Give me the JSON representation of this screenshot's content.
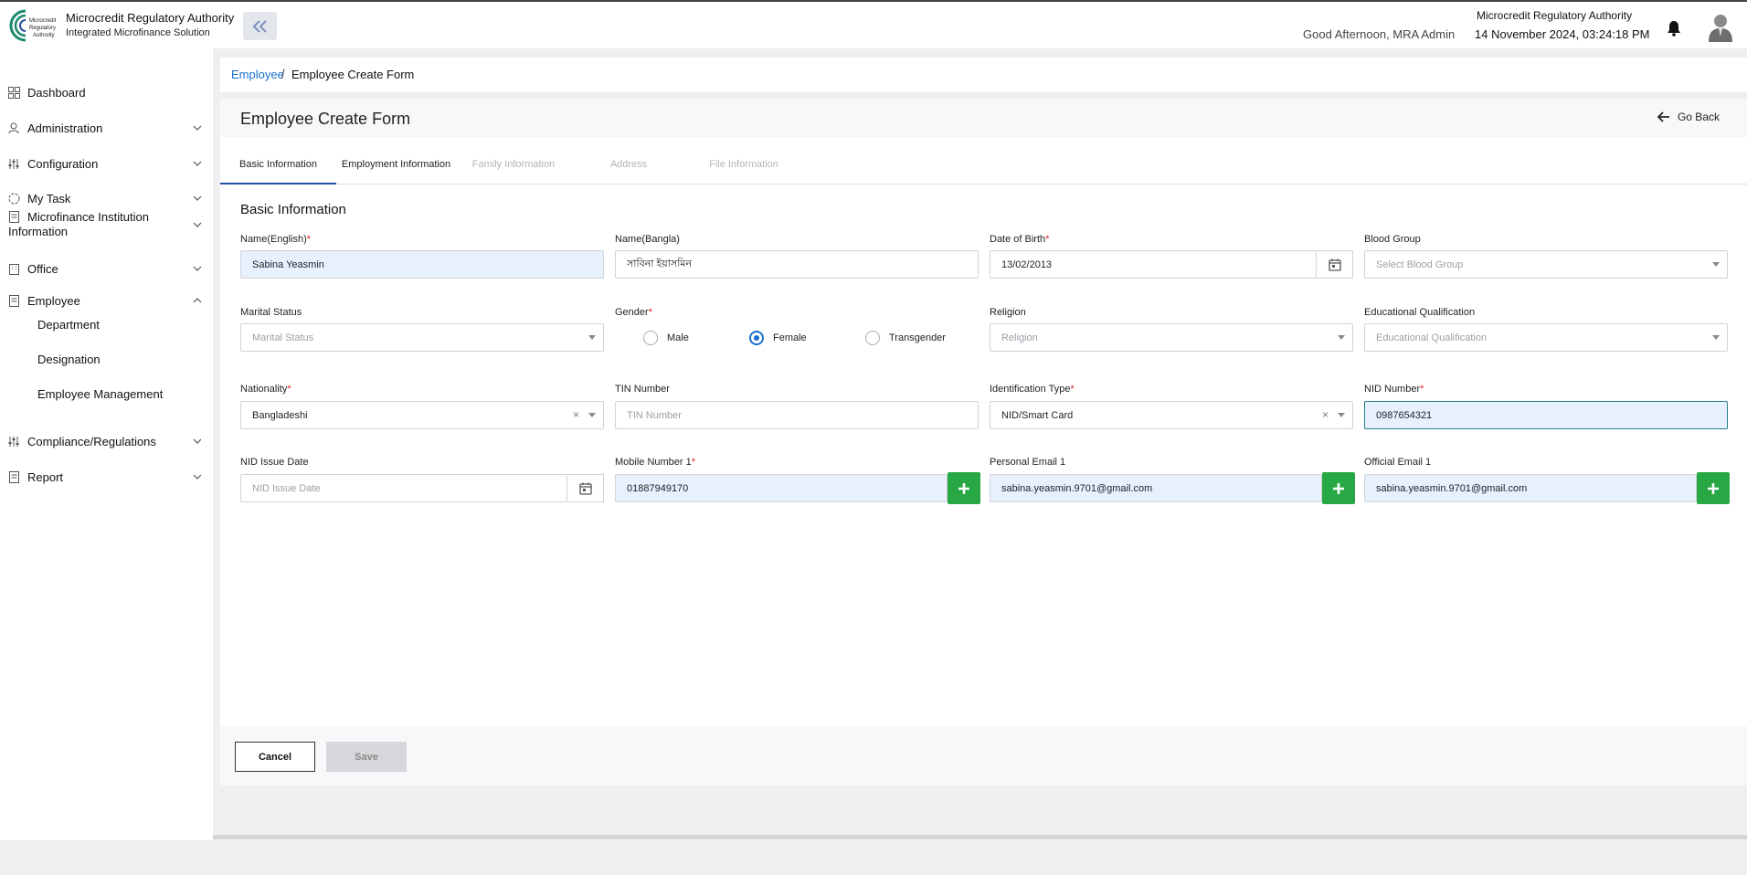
{
  "header": {
    "org_name": "Microcredit Regulatory Authority",
    "org_subtitle": "Integrated Microfinance Solution",
    "logo_text": [
      "Microcredit",
      "Regulatory",
      "Authority"
    ],
    "greeting": "Good Afternoon, MRA Admin",
    "top_org": "Microcredit Regulatory Authority",
    "datetime": "14 November 2024, 03:24:18 PM"
  },
  "sidebar": {
    "items": [
      {
        "label": "Dashboard",
        "icon": "grid-icon"
      },
      {
        "label": "Administration",
        "icon": "user-gear-icon"
      },
      {
        "label": "Configuration",
        "icon": "sliders-icon"
      },
      {
        "label": "My Task",
        "icon": "circle-task-icon"
      },
      {
        "label": "Microfinance Institution Information",
        "icon": "document-icon"
      },
      {
        "label": "Office",
        "icon": "office-icon"
      },
      {
        "label": "Employee",
        "icon": "document-icon"
      },
      {
        "label": "Compliance/Regulations",
        "icon": "sliders-icon"
      },
      {
        "label": "Report",
        "icon": "document-icon"
      }
    ],
    "employee_sub": [
      "Department",
      "Designation",
      "Employee Management"
    ]
  },
  "breadcrumb": {
    "parent": "Employee",
    "separator": "/",
    "current": "Employee Create Form"
  },
  "form": {
    "title": "Employee Create Form",
    "go_back": "Go Back",
    "tabs": [
      "Basic Information",
      "Employment Information",
      "Family Information",
      "Address",
      "File Information"
    ],
    "section_title": "Basic Information",
    "labels": {
      "name_en": "Name(English)",
      "name_bn": "Name(Bangla)",
      "dob": "Date of Birth",
      "blood": "Blood Group",
      "marital": "Marital Status",
      "gender": "Gender",
      "religion": "Religion",
      "education": "Educational Qualification",
      "nationality": "Nationality",
      "tin": "TIN Number",
      "id_type": "Identification Type",
      "nid": "NID Number",
      "nid_issue": "NID Issue Date",
      "mobile": "Mobile Number 1",
      "personal_email": "Personal Email 1",
      "official_email": "Official Email 1"
    },
    "values": {
      "name_en": "Sabina Yeasmin",
      "name_bn": "সাবিনা ইয়াসমিন",
      "dob": "13/02/2013",
      "nationality": "Bangladeshi",
      "id_type": "NID/Smart Card",
      "nid": "0987654321",
      "mobile": "01887949170",
      "personal_email": "sabina.yeasmin.9701@gmail.com",
      "official_email": "sabina.yeasmin.9701@gmail.com"
    },
    "placeholders": {
      "blood": "Select Blood Group",
      "marital": "Marital Status",
      "religion": "Religion",
      "education": "Educational Qualification",
      "tin": "TIN Number",
      "nid_issue": "NID Issue Date"
    },
    "gender_options": [
      "Male",
      "Female",
      "Transgender"
    ],
    "gender_selected": "Female",
    "required_mark": "*",
    "clear_glyph": "×",
    "buttons": {
      "cancel": "Cancel",
      "save": "Save"
    }
  },
  "colors": {
    "accent": "#1a6fd0",
    "add_button": "#27a844",
    "required": "#e02020"
  }
}
